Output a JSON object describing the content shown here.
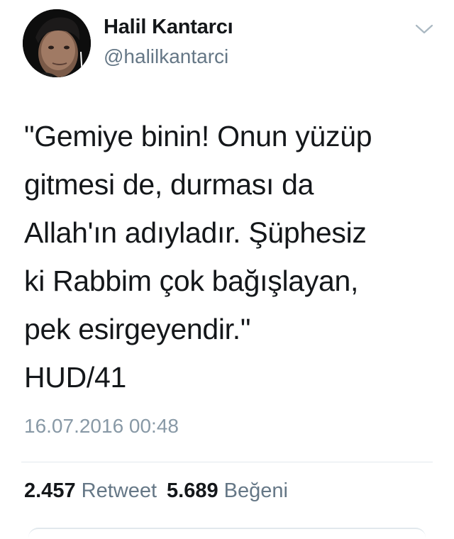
{
  "user": {
    "name": "Halil Kantarcı",
    "handle": "@halilkantarci"
  },
  "tweet": {
    "lines": [
      "\"Gemiye binin! Onun yüzüp",
      "gitmesi de, durması da",
      "Allah'ın adıyladır. Şüphesiz",
      "ki Rabbim çok bağışlayan,",
      "pek esirgeyendir.\"",
      "HUD/41"
    ],
    "timestamp": "16.07.2016 00:48"
  },
  "stats": {
    "retweets": "2.457",
    "retweet_label": "Retweet",
    "likes": "5.689",
    "like_label": "Beğeni"
  },
  "icons": {
    "menu": "chevron-down-icon"
  },
  "colors": {
    "text": "#14171a",
    "secondary": "#657786",
    "timestamp": "#8899a6",
    "divider": "#e1e8ed"
  }
}
